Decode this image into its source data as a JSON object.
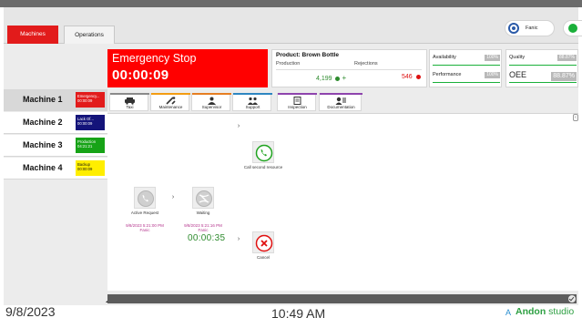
{
  "nav": {
    "tabs": [
      {
        "label": "Machines",
        "active": true
      },
      {
        "label": "Operations",
        "active": false
      }
    ],
    "user": {
      "name": "Fanic",
      "icon": "user-circle-icon"
    },
    "status": {
      "icon": "status-dot-icon",
      "color": "#1ab03a"
    }
  },
  "estop": {
    "title": "Emergency Stop",
    "timer": "00:00:09",
    "color": "#ff0000"
  },
  "product": {
    "name": "Product: Brown Bottle",
    "production_label": "Production",
    "rejections_label": "Rejections",
    "production_value": "4,199",
    "rejections_value": "546",
    "production_color": "#2e8b2e",
    "rejections_color": "#d11111"
  },
  "kpis": {
    "availability": {
      "label": "Availability",
      "value": "100%"
    },
    "quality": {
      "label": "Quality",
      "value": "88.87%"
    },
    "performance": {
      "label": "Performance",
      "value": "100%"
    },
    "oee": {
      "label": "OEE",
      "value": "88.87%"
    }
  },
  "machines": [
    {
      "name": "Machine 1",
      "badge": "Emergency... 00:00:09",
      "badge_color": "#e21b1b",
      "badge_text_color": "#ffffff",
      "active": true
    },
    {
      "name": "Machine 2",
      "badge": "Lack Of... 00:00:09",
      "badge_color": "#14147a",
      "badge_text_color": "#ffffff",
      "active": false
    },
    {
      "name": "Machine 3",
      "badge": "Production 04:21:21",
      "badge_color": "#17a317",
      "badge_text_color": "#ffffff",
      "active": false
    },
    {
      "name": "Machine 4",
      "badge": "Backup 00:00:09",
      "badge_color": "#ffee00",
      "badge_text_color": "#111111",
      "active": false
    }
  ],
  "content_tabs": [
    {
      "label": "Taxi",
      "icon": "taxi-icon",
      "stripe": "#8a8a8a"
    },
    {
      "label": "Maintenance",
      "icon": "tools-icon",
      "stripe": "#f39c12"
    },
    {
      "label": "Supervisor",
      "icon": "supervisor-icon",
      "stripe": "#e67e22"
    },
    {
      "label": "Support",
      "icon": "support-icon",
      "stripe": "#2e86c1",
      "active": true
    },
    {
      "label": "Inspection",
      "icon": "inspection-icon",
      "stripe": "#8e44ad"
    },
    {
      "label": "Documentation",
      "icon": "documentation-icon",
      "stripe": "#8e44ad"
    }
  ],
  "workflow": {
    "active_request": {
      "label": "Active Request",
      "time": "9/8/2023 5:21:00 PM",
      "user": "Fanic"
    },
    "waiting": {
      "label": "Waiting",
      "time": "9/8/2023 5:21:16 PM",
      "user": "Fanic",
      "elapsed": "00:00:35"
    },
    "call_second": {
      "label": "Call second resource"
    },
    "cancel": {
      "label": "Cancel"
    }
  },
  "footer": {
    "date": "9/8/2023",
    "time": "10:49 AM",
    "brand_bold": "Andon",
    "brand_rest": " studio"
  }
}
